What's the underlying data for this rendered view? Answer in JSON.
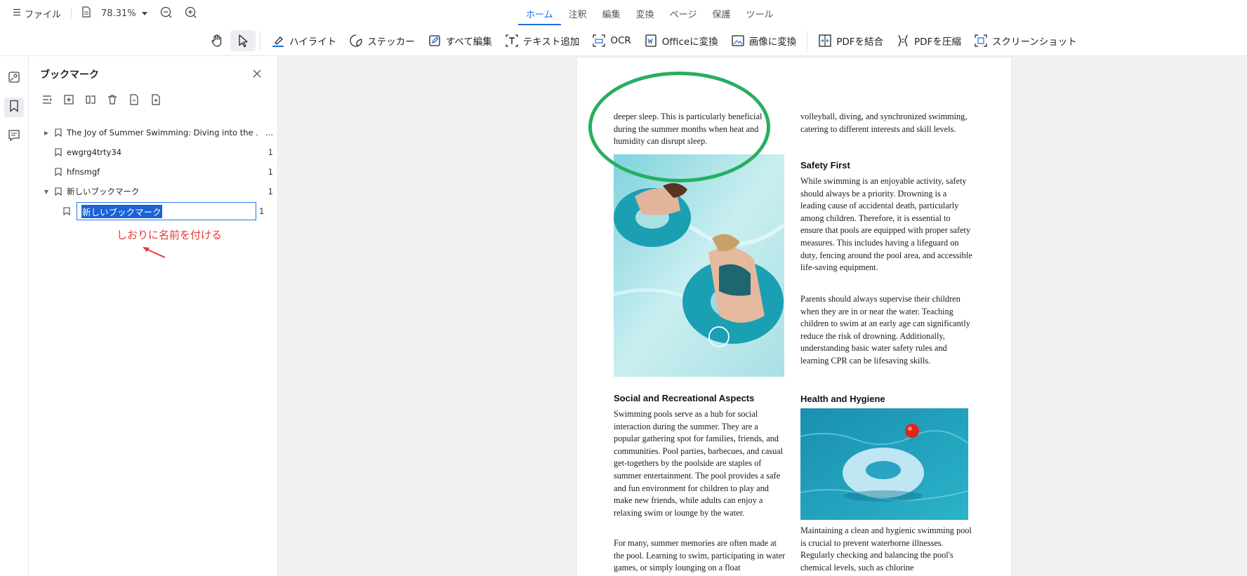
{
  "topbar": {
    "file_label": "ファイル",
    "zoom": "78.31%",
    "tabs": [
      {
        "label": "ホーム",
        "active": true
      },
      {
        "label": "注釈"
      },
      {
        "label": "編集"
      },
      {
        "label": "変換"
      },
      {
        "label": "ページ"
      },
      {
        "label": "保護"
      },
      {
        "label": "ツール"
      }
    ],
    "tools": {
      "highlight": "ハイライト",
      "sticker": "ステッカー",
      "edit_all": "すべて編集",
      "add_text": "テキスト追加",
      "ocr": "OCR",
      "to_office": "Officeに変換",
      "to_image": "画像に変換",
      "merge_pdf": "PDFを結合",
      "compress_pdf": "PDFを圧縮",
      "screenshot": "スクリーンショット"
    }
  },
  "panel": {
    "title": "ブックマーク",
    "bookmarks": [
      {
        "label": "The Joy of Summer Swimming: Diving into the ...",
        "page": "...",
        "expandable": true
      },
      {
        "label": "ewgrg4trty34",
        "page": "1"
      },
      {
        "label": "hfnsmgf",
        "page": "1"
      },
      {
        "label": "新しいブックマーク",
        "page": "1",
        "expanded": true
      }
    ],
    "editing": {
      "value": "新しいブックマーク",
      "page": "1"
    },
    "annotation": "しおりに名前を付ける"
  },
  "document": {
    "col1_top": "deeper sleep. This is particularly beneficial during the summer months when heat and humidity can disrupt sleep.",
    "col2_top": "volleyball, diving, and synchronized swimming, catering to different interests and skill levels.",
    "safety_heading": "Safety First",
    "safety_p1": "While swimming is an enjoyable activity, safety should always be a priority. Drowning is a leading cause of accidental death, particularly among children. Therefore, it is essential to ensure that pools are equipped with proper safety measures. This includes having a lifeguard on duty, fencing around the pool area, and accessible life-saving equipment.",
    "safety_p2": "Parents should always supervise their children when they are in or near the water. Teaching children to swim at an early age can significantly reduce the risk of drowning. Additionally, understanding basic water safety rules and learning CPR can be lifesaving skills.",
    "social_heading": "Social and Recreational Aspects",
    "social_p1": "Swimming pools serve as a hub for social interaction during the summer. They are a popular gathering spot for families, friends, and communities. Pool parties, barbecues, and casual get-togethers by the poolside are staples of summer entertainment. The pool provides a safe and fun environment for children to play and make new friends, while adults can enjoy a relaxing swim or lounge by the water.",
    "social_p2": "For many, summer memories are often made at the pool. Learning to swim, participating in water games, or simply lounging on a float",
    "health_heading": "Health and Hygiene",
    "health_p1": "Maintaining a clean and hygienic swimming pool is crucial to prevent waterborne illnesses. Regularly checking and balancing the pool's chemical levels, such as chlorine"
  },
  "colors": {
    "accent": "#1f6fe0",
    "annotation_red": "#e53935",
    "circle_green": "#27ae60",
    "selection_blue": "#1a62d6"
  }
}
